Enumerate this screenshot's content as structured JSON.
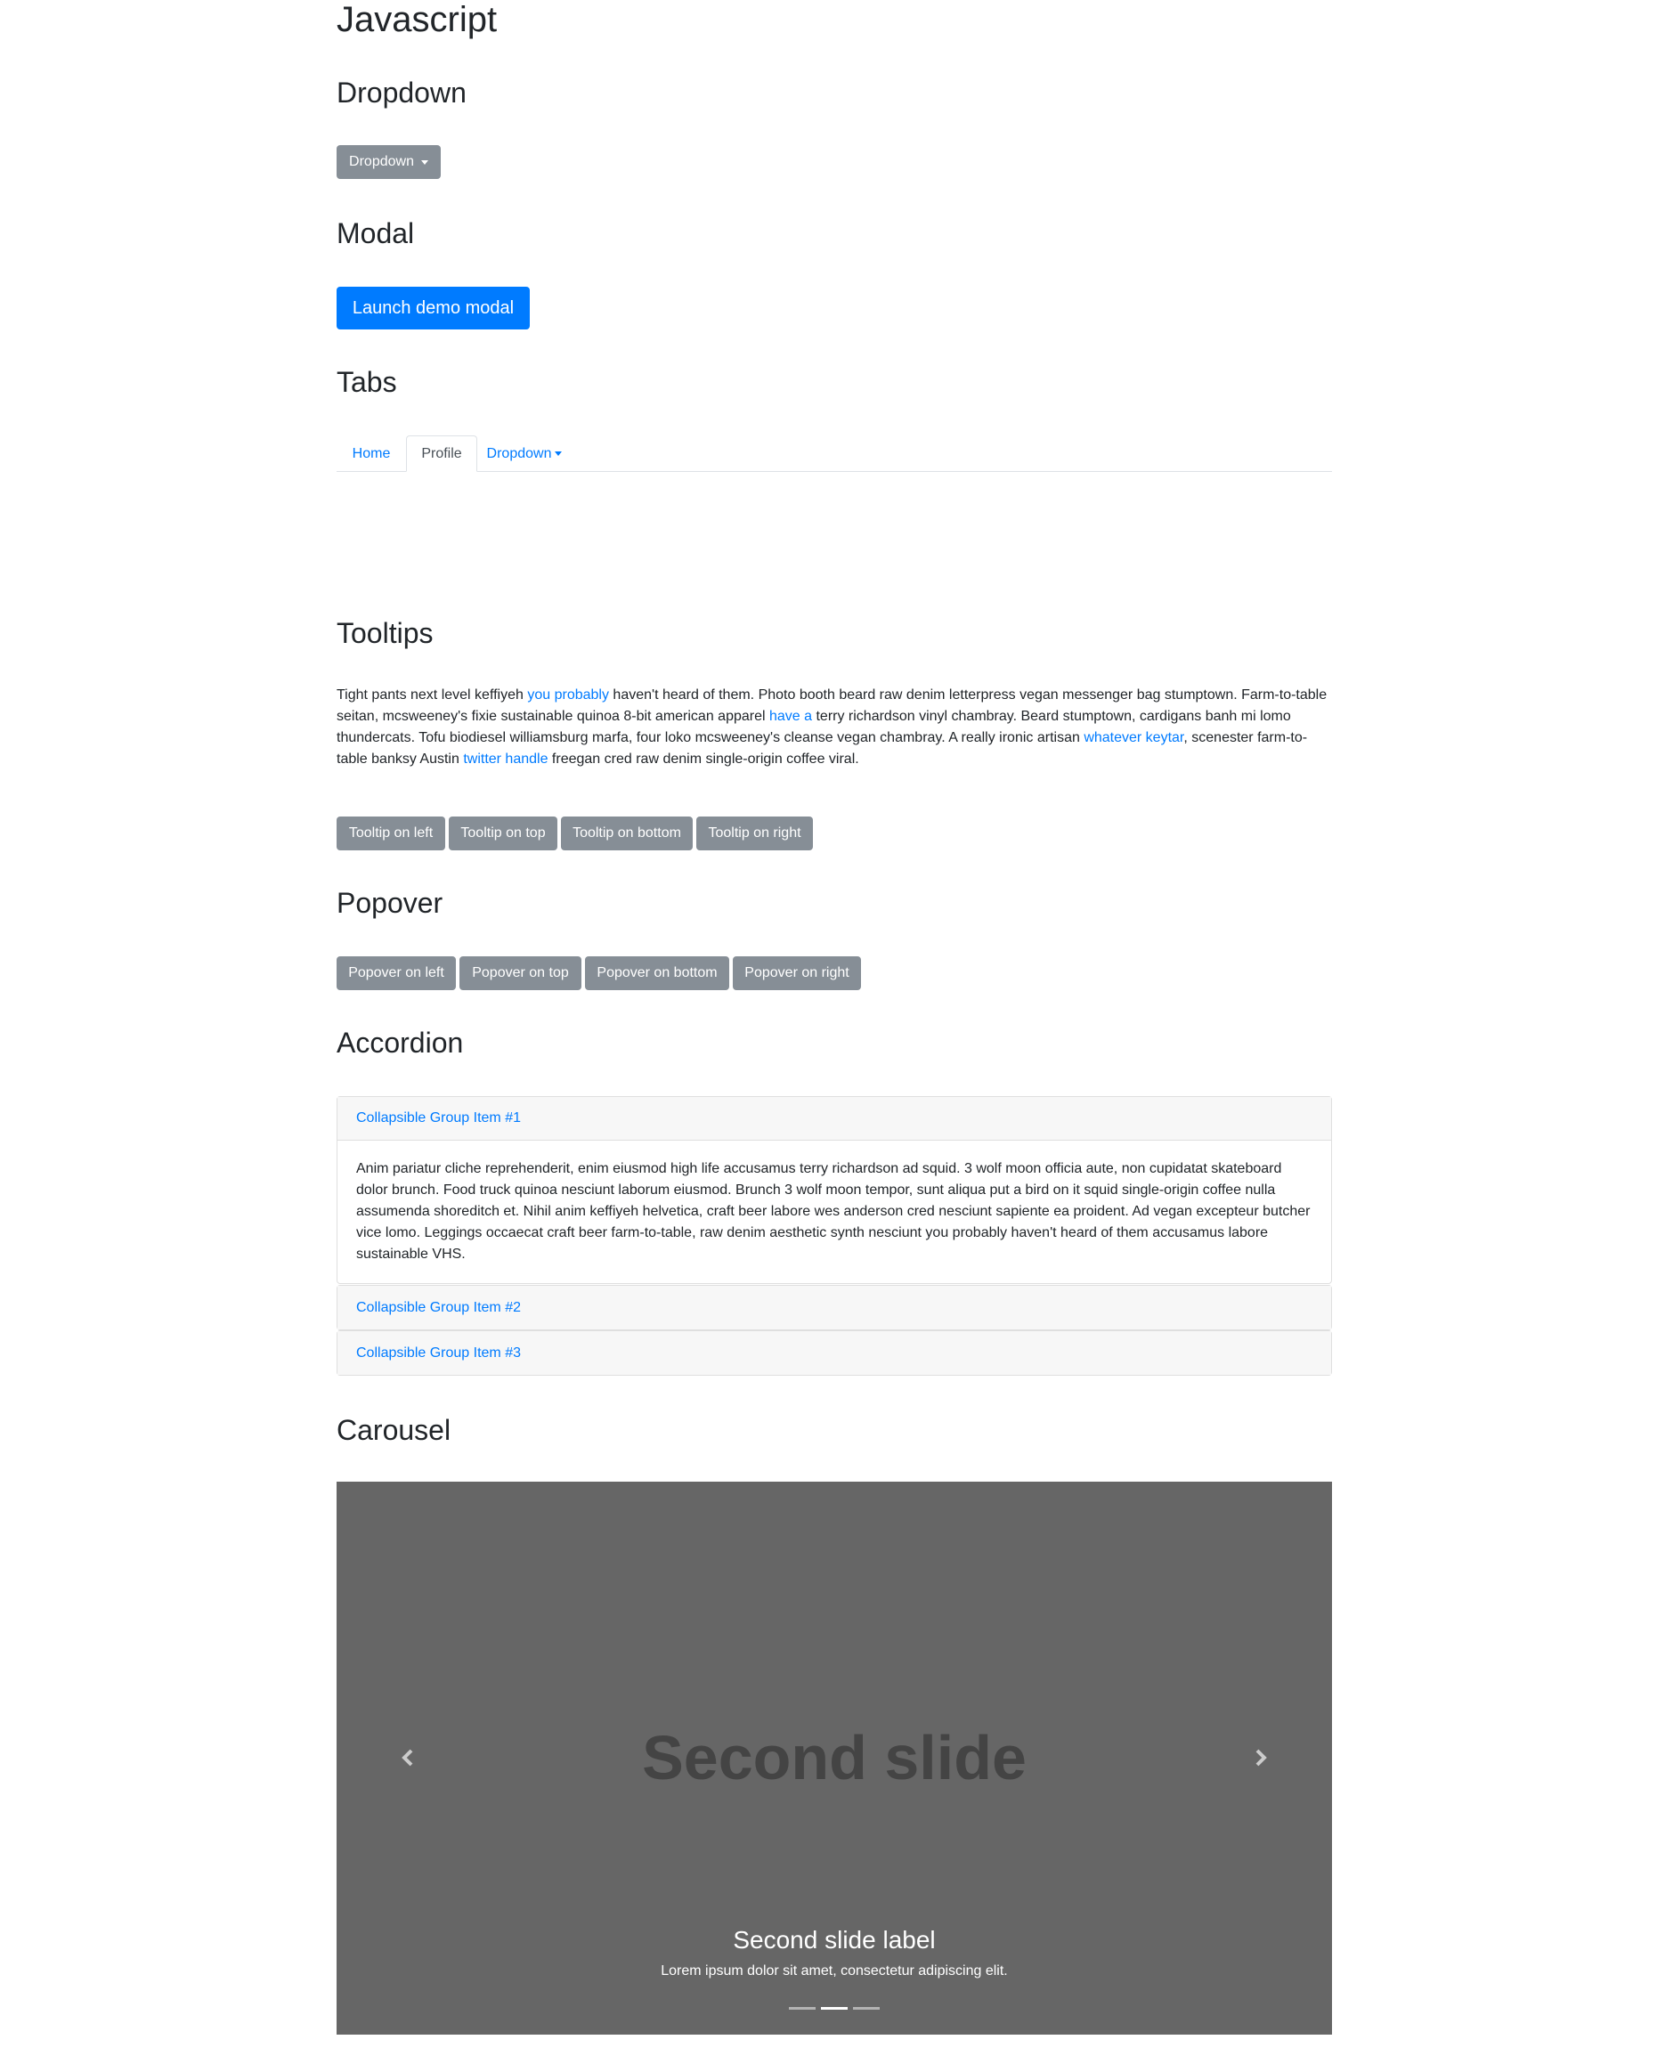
{
  "page": {
    "title": "Javascript"
  },
  "dropdown_section": {
    "heading": "Dropdown",
    "button_label": "Dropdown"
  },
  "modal_section": {
    "heading": "Modal",
    "button_label": "Launch demo modal"
  },
  "tabs_section": {
    "heading": "Tabs",
    "tabs": [
      {
        "label": "Home",
        "active": false
      },
      {
        "label": "Profile",
        "active": true
      },
      {
        "label": "Dropdown",
        "active": false
      }
    ]
  },
  "tooltips_section": {
    "heading": "Tooltips",
    "paragraph": {
      "t1": "Tight pants next level keffiyeh ",
      "l1": "you probably",
      "t2": " haven't heard of them. Photo booth beard raw denim letterpress vegan messenger bag stumptown. Farm-to-table seitan, mcsweeney's fixie sustainable quinoa 8-bit american apparel ",
      "l2": "have a",
      "t3": " terry richardson vinyl chambray. Beard stumptown, cardigans banh mi lomo thundercats. Tofu biodiesel williamsburg marfa, four loko mcsweeney's cleanse vegan chambray. A really ironic artisan ",
      "l3": "whatever keytar",
      "t4": ", scenester farm-to-table banksy Austin ",
      "l4": "twitter handle",
      "t5": " freegan cred raw denim single-origin coffee viral."
    },
    "buttons": [
      "Tooltip on left",
      "Tooltip on top",
      "Tooltip on bottom",
      "Tooltip on right"
    ]
  },
  "popover_section": {
    "heading": "Popover",
    "buttons": [
      "Popover on left",
      "Popover on top",
      "Popover on bottom",
      "Popover on right"
    ]
  },
  "accordion_section": {
    "heading": "Accordion",
    "items": [
      {
        "title": "Collapsible Group Item #1",
        "expanded": true,
        "body": "Anim pariatur cliche reprehenderit, enim eiusmod high life accusamus terry richardson ad squid. 3 wolf moon officia aute, non cupidatat skateboard dolor brunch. Food truck quinoa nesciunt laborum eiusmod. Brunch 3 wolf moon tempor, sunt aliqua put a bird on it squid single-origin coffee nulla assumenda shoreditch et. Nihil anim keffiyeh helvetica, craft beer labore wes anderson cred nesciunt sapiente ea proident. Ad vegan excepteur butcher vice lomo. Leggings occaecat craft beer farm-to-table, raw denim aesthetic synth nesciunt you probably haven't heard of them accusamus labore sustainable VHS."
      },
      {
        "title": "Collapsible Group Item #2",
        "expanded": false
      },
      {
        "title": "Collapsible Group Item #3",
        "expanded": false
      }
    ]
  },
  "carousel_section": {
    "heading": "Carousel",
    "slide_text": "Second slide",
    "caption_title": "Second slide label",
    "caption_text": "Lorem ipsum dolor sit amet, consectetur adipiscing elit.",
    "active_index": 1,
    "indicator_count": 3,
    "prev_icon": "chevron-left-icon",
    "next_icon": "chevron-right-icon"
  },
  "colors": {
    "primary": "#007bff",
    "secondary": "#868e96",
    "carousel_bg": "#666666"
  }
}
